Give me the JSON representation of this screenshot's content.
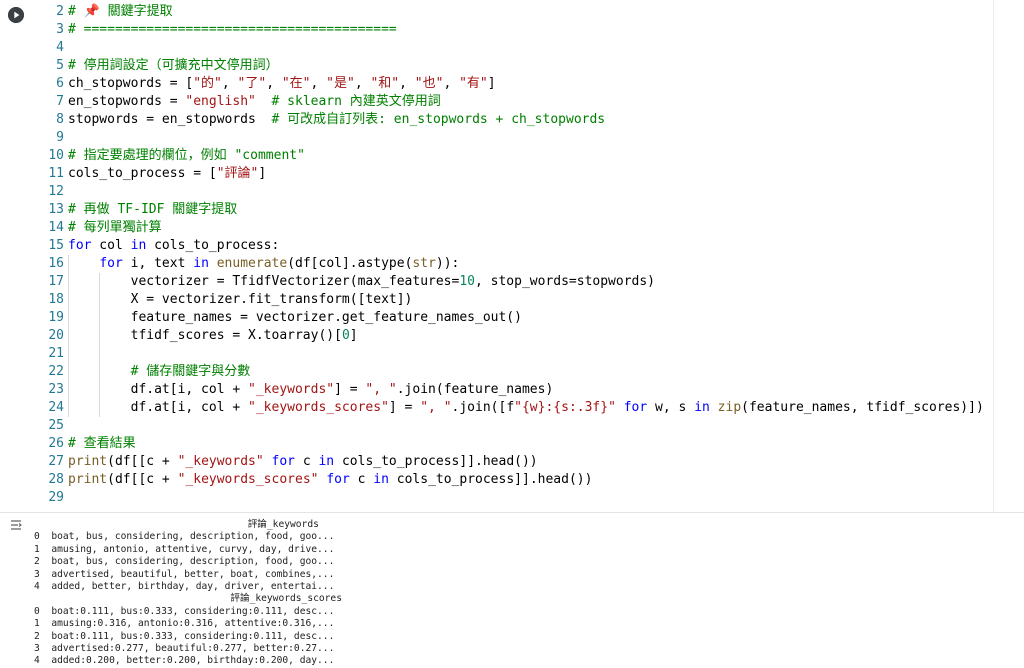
{
  "code_lines": [
    {
      "n": "2",
      "parts": [
        [
          "cm",
          "# 📌 關鍵字提取"
        ]
      ]
    },
    {
      "n": "3",
      "parts": [
        [
          "cm",
          "# ========================================"
        ]
      ]
    },
    {
      "n": "4",
      "parts": []
    },
    {
      "n": "5",
      "parts": [
        [
          "cm",
          "# 停用詞設定（可擴充中文停用詞）"
        ]
      ]
    },
    {
      "n": "6",
      "parts": [
        [
          "op",
          "ch_stopwords = ["
        ],
        [
          "str",
          "\"的\""
        ],
        [
          "op",
          ", "
        ],
        [
          "str",
          "\"了\""
        ],
        [
          "op",
          ", "
        ],
        [
          "str",
          "\"在\""
        ],
        [
          "op",
          ", "
        ],
        [
          "str",
          "\"是\""
        ],
        [
          "op",
          ", "
        ],
        [
          "str",
          "\"和\""
        ],
        [
          "op",
          ", "
        ],
        [
          "str",
          "\"也\""
        ],
        [
          "op",
          ", "
        ],
        [
          "str",
          "\"有\""
        ],
        [
          "op",
          "]"
        ]
      ]
    },
    {
      "n": "7",
      "parts": [
        [
          "op",
          "en_stopwords = "
        ],
        [
          "str",
          "\"english\""
        ],
        [
          "op",
          "  "
        ],
        [
          "cm",
          "# sklearn 內建英文停用詞"
        ]
      ]
    },
    {
      "n": "8",
      "parts": [
        [
          "op",
          "stopwords = en_stopwords  "
        ],
        [
          "cm",
          "# 可改成自訂列表: en_stopwords + ch_stopwords"
        ]
      ]
    },
    {
      "n": "9",
      "parts": []
    },
    {
      "n": "10",
      "parts": [
        [
          "cm",
          "# 指定要處理的欄位，例如 \"comment\""
        ]
      ]
    },
    {
      "n": "11",
      "parts": [
        [
          "op",
          "cols_to_process = ["
        ],
        [
          "str",
          "\"評論\""
        ],
        [
          "op",
          "]"
        ]
      ]
    },
    {
      "n": "12",
      "parts": []
    },
    {
      "n": "13",
      "parts": [
        [
          "cm",
          "# 再做 TF-IDF 關鍵字提取"
        ]
      ]
    },
    {
      "n": "14",
      "parts": [
        [
          "cm",
          "# 每列單獨計算"
        ]
      ]
    },
    {
      "n": "15",
      "parts": [
        [
          "kw",
          "for"
        ],
        [
          "op",
          " col "
        ],
        [
          "kw",
          "in"
        ],
        [
          "op",
          " cols_to_process:"
        ]
      ]
    },
    {
      "n": "16",
      "indent": 1,
      "parts": [
        [
          "op",
          "    "
        ],
        [
          "kw",
          "for"
        ],
        [
          "op",
          " i, text "
        ],
        [
          "kw",
          "in"
        ],
        [
          "op",
          " "
        ],
        [
          "fn",
          "enumerate"
        ],
        [
          "op",
          "(df[col].astype("
        ],
        [
          "fn",
          "str"
        ],
        [
          "op",
          ")):"
        ]
      ]
    },
    {
      "n": "17",
      "indent": 2,
      "parts": [
        [
          "op",
          "        vectorizer = TfidfVectorizer(max_features="
        ],
        [
          "num",
          "10"
        ],
        [
          "op",
          ", stop_words=stopwords)"
        ]
      ]
    },
    {
      "n": "18",
      "indent": 2,
      "parts": [
        [
          "op",
          "        X = vectorizer.fit_transform([text])"
        ]
      ]
    },
    {
      "n": "19",
      "indent": 2,
      "parts": [
        [
          "op",
          "        feature_names = vectorizer.get_feature_names_out()"
        ]
      ]
    },
    {
      "n": "20",
      "indent": 2,
      "parts": [
        [
          "op",
          "        tfidf_scores = X.toarray()["
        ],
        [
          "num",
          "0"
        ],
        [
          "op",
          "]"
        ]
      ]
    },
    {
      "n": "21",
      "indent": 2,
      "parts": []
    },
    {
      "n": "22",
      "indent": 2,
      "parts": [
        [
          "op",
          "        "
        ],
        [
          "cm",
          "# 儲存關鍵字與分數"
        ]
      ]
    },
    {
      "n": "23",
      "indent": 2,
      "parts": [
        [
          "op",
          "        df.at[i, col + "
        ],
        [
          "str",
          "\"_keywords\""
        ],
        [
          "op",
          "] = "
        ],
        [
          "str",
          "\", \""
        ],
        [
          "op",
          ".join(feature_names)"
        ]
      ]
    },
    {
      "n": "24",
      "indent": 2,
      "parts": [
        [
          "op",
          "        df.at[i, col + "
        ],
        [
          "str",
          "\"_keywords_scores\""
        ],
        [
          "op",
          "] = "
        ],
        [
          "str",
          "\", \""
        ],
        [
          "op",
          ".join([f"
        ],
        [
          "str",
          "\"{w}:{s:.3f}\""
        ],
        [
          "op",
          " "
        ],
        [
          "kw",
          "for"
        ],
        [
          "op",
          " w, s "
        ],
        [
          "kw",
          "in"
        ],
        [
          "op",
          " "
        ],
        [
          "fn",
          "zip"
        ],
        [
          "op",
          "(feature_names, tfidf_scores)])"
        ]
      ]
    },
    {
      "n": "25",
      "parts": []
    },
    {
      "n": "26",
      "parts": [
        [
          "cm",
          "# 查看結果"
        ]
      ]
    },
    {
      "n": "27",
      "parts": [
        [
          "fn",
          "print"
        ],
        [
          "op",
          "(df[[c + "
        ],
        [
          "str",
          "\"_keywords\""
        ],
        [
          "op",
          " "
        ],
        [
          "kw",
          "for"
        ],
        [
          "op",
          " c "
        ],
        [
          "kw",
          "in"
        ],
        [
          "op",
          " cols_to_process]].head())"
        ]
      ]
    },
    {
      "n": "28",
      "parts": [
        [
          "fn",
          "print"
        ],
        [
          "op",
          "(df[[c + "
        ],
        [
          "str",
          "\"_keywords_scores\""
        ],
        [
          "op",
          " "
        ],
        [
          "kw",
          "for"
        ],
        [
          "op",
          " c "
        ],
        [
          "kw",
          "in"
        ],
        [
          "op",
          " cols_to_process]].head())"
        ]
      ]
    },
    {
      "n": "29",
      "parts": []
    }
  ],
  "output_lines": [
    "                                     評論_keywords",
    "0  boat, bus, considering, description, food, goo...",
    "1  amusing, antonio, attentive, curvy, day, drive...",
    "2  boat, bus, considering, description, food, goo...",
    "3  advertised, beautiful, better, boat, combines,...",
    "4  added, better, birthday, day, driver, entertai...",
    "                                  評論_keywords_scores",
    "0  boat:0.111, bus:0.333, considering:0.111, desc...",
    "1  amusing:0.316, antonio:0.316, attentive:0.316,...",
    "2  boat:0.111, bus:0.333, considering:0.111, desc...",
    "3  advertised:0.277, beautiful:0.277, better:0.27...",
    "4  added:0.200, better:0.200, birthday:0.200, day..."
  ],
  "icons": {
    "run": "run-cell-icon",
    "output": "output-collapse-icon"
  }
}
